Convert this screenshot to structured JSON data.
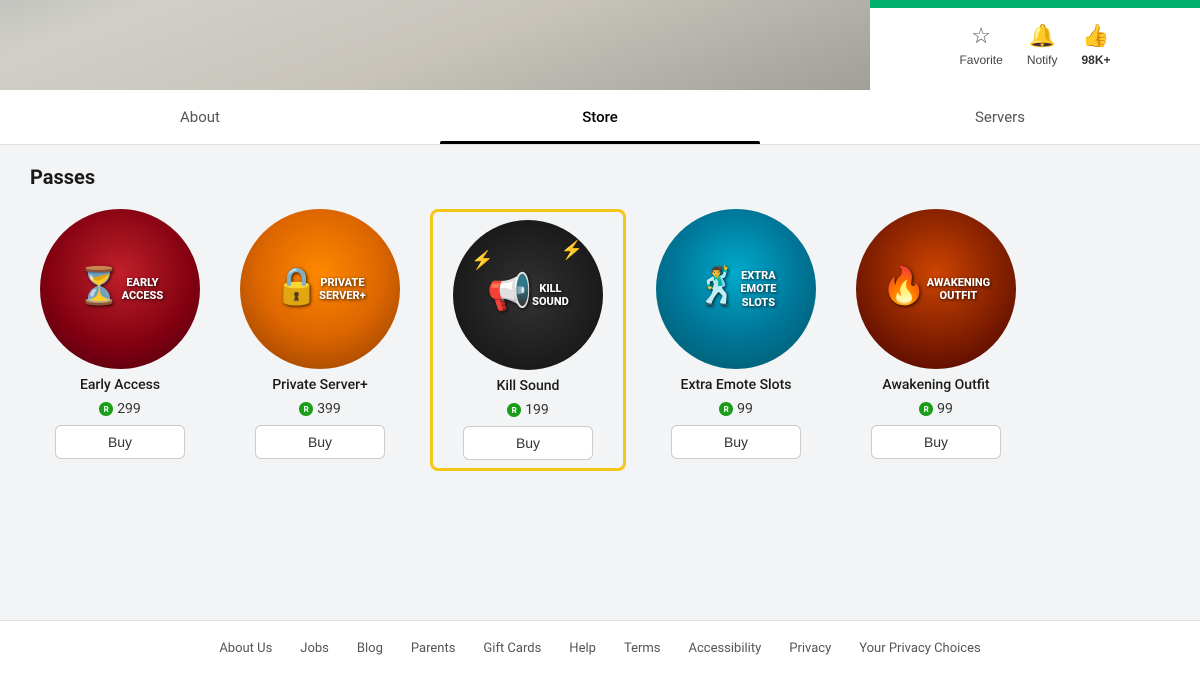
{
  "header": {
    "favorite_label": "Favorite",
    "notify_label": "Notify",
    "count_label": "98K+"
  },
  "tabs": {
    "about_label": "About",
    "store_label": "Store",
    "servers_label": "Servers",
    "active": "Store"
  },
  "passes_section": {
    "title": "Passes",
    "items": [
      {
        "id": "early-access",
        "name": "Early Access",
        "price": "299",
        "buy_label": "Buy",
        "highlighted": false,
        "image_text": "EARLY ACCESS",
        "icon": "⏳"
      },
      {
        "id": "private-server",
        "name": "Private Server+",
        "price": "399",
        "buy_label": "Buy",
        "highlighted": false,
        "image_text": "PRIVATE SERVER+",
        "icon": "🔒"
      },
      {
        "id": "kill-sound",
        "name": "Kill Sound",
        "price": "199",
        "buy_label": "Buy",
        "highlighted": true,
        "image_text": "KILL SOUND",
        "icon": "📢"
      },
      {
        "id": "extra-emote",
        "name": "Extra Emote Slots",
        "price": "99",
        "buy_label": "Buy",
        "highlighted": false,
        "image_text": "EXTRA EMOTE SLOTS",
        "icon": "🕺"
      },
      {
        "id": "awakening",
        "name": "Awakening Outfit",
        "price": "99",
        "buy_label": "Buy",
        "highlighted": false,
        "image_text": "AWAKENING OUTFIT",
        "icon": "🔥"
      }
    ]
  },
  "footer": {
    "links": [
      {
        "id": "about-us",
        "label": "About Us"
      },
      {
        "id": "jobs",
        "label": "Jobs"
      },
      {
        "id": "blog",
        "label": "Blog"
      },
      {
        "id": "parents",
        "label": "Parents"
      },
      {
        "id": "gift-cards",
        "label": "Gift Cards"
      },
      {
        "id": "help",
        "label": "Help"
      },
      {
        "id": "terms",
        "label": "Terms"
      },
      {
        "id": "accessibility",
        "label": "Accessibility"
      },
      {
        "id": "privacy",
        "label": "Privacy"
      },
      {
        "id": "your-privacy",
        "label": "Your Privacy Choices"
      }
    ]
  }
}
